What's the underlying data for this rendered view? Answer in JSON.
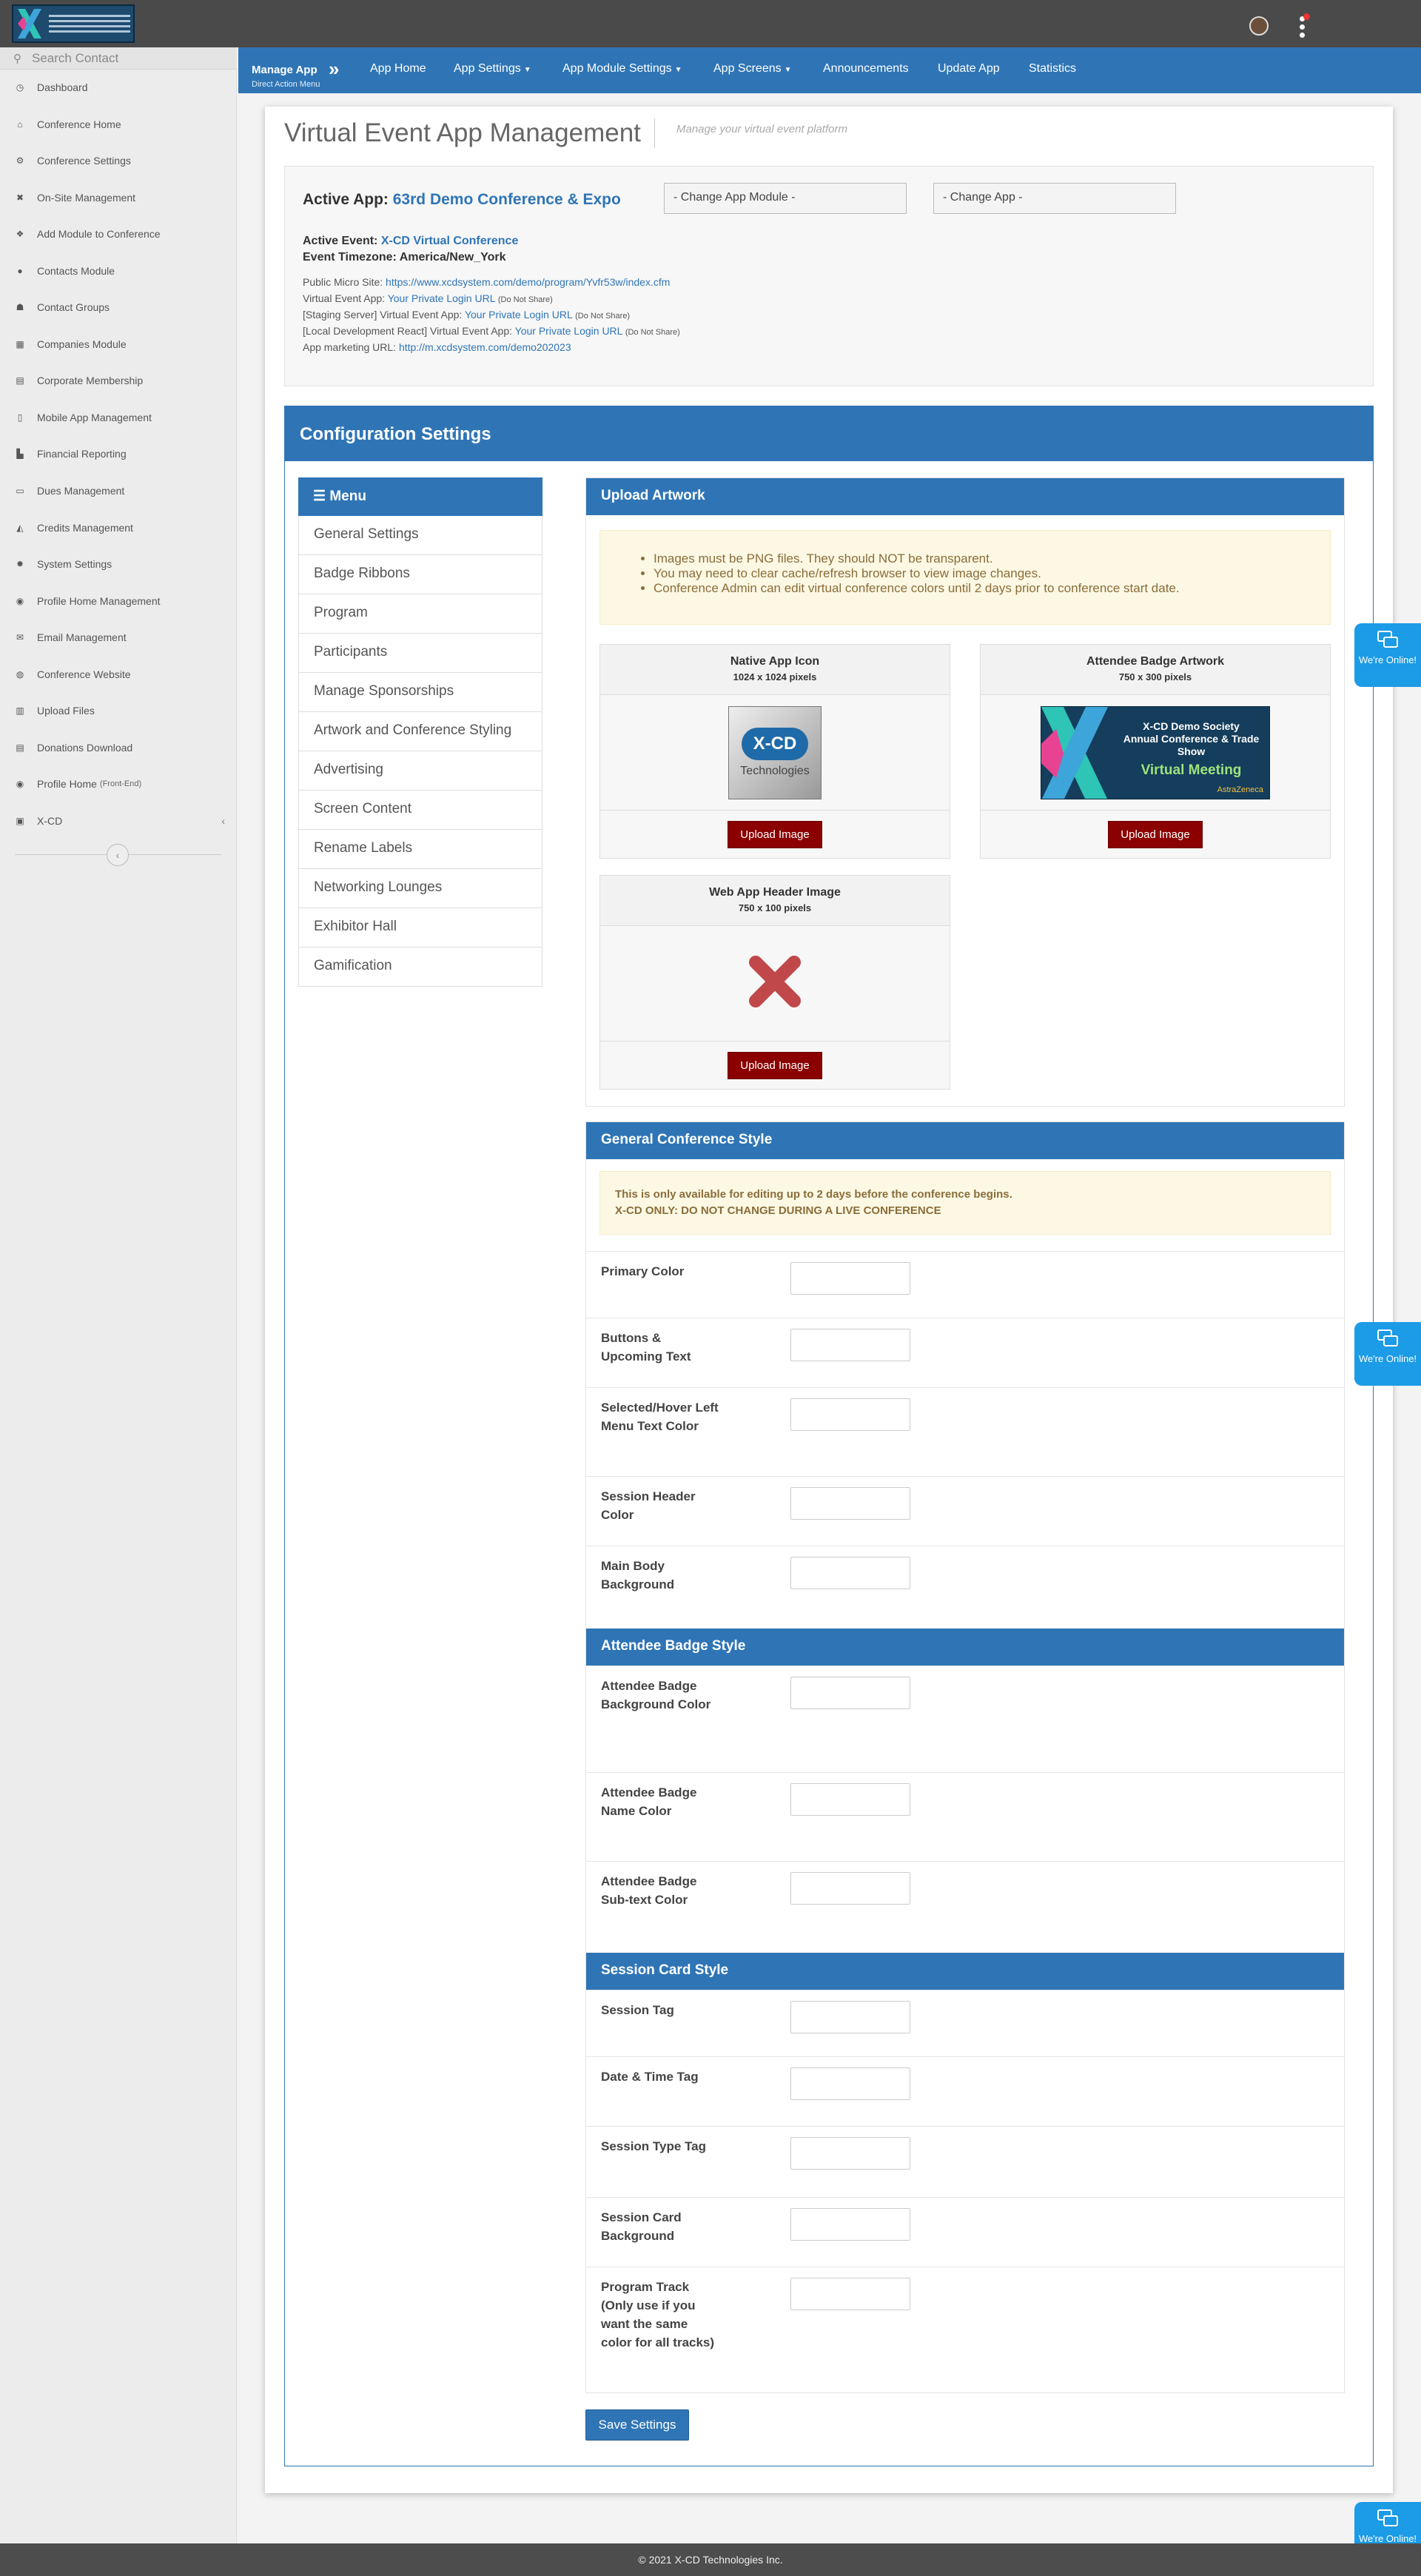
{
  "sidebar": {
    "search_placeholder": "Search Contact",
    "items": [
      {
        "icon": "dashboard-icon",
        "glyph": "◷",
        "label": "Dashboard"
      },
      {
        "icon": "home-icon",
        "glyph": "⌂",
        "label": "Conference Home"
      },
      {
        "icon": "gears-icon",
        "glyph": "⚙",
        "label": "Conference Settings"
      },
      {
        "icon": "tools-icon",
        "glyph": "✖",
        "label": "On-Site Management"
      },
      {
        "icon": "cubes-icon",
        "glyph": "❖",
        "label": "Add Module to Conference"
      },
      {
        "icon": "user-icon",
        "glyph": "●",
        "label": "Contacts Module"
      },
      {
        "icon": "users-icon",
        "glyph": "☗",
        "label": "Contact Groups"
      },
      {
        "icon": "building-icon",
        "glyph": "▦",
        "label": "Companies Module"
      },
      {
        "icon": "book-icon",
        "glyph": "▤",
        "label": "Corporate Membership"
      },
      {
        "icon": "mobile-icon",
        "glyph": "▯",
        "label": "Mobile App Management"
      },
      {
        "icon": "chart-icon",
        "glyph": "▙",
        "label": "Financial Reporting"
      },
      {
        "icon": "money-icon",
        "glyph": "▭",
        "label": "Dues Management"
      },
      {
        "icon": "graduation-icon",
        "glyph": "◭",
        "label": "Credits Management"
      },
      {
        "icon": "cog-icon",
        "glyph": "✹",
        "label": "System Settings"
      },
      {
        "icon": "user-circle-icon",
        "glyph": "◉",
        "label": "Profile Home Management"
      },
      {
        "icon": "envelope-icon",
        "glyph": "✉",
        "label": "Email Management"
      },
      {
        "icon": "globe-icon",
        "glyph": "◍",
        "label": "Conference Website"
      },
      {
        "icon": "upload-icon",
        "glyph": "▥",
        "label": "Upload Files"
      },
      {
        "icon": "download-icon",
        "glyph": "▤",
        "label": "Donations Download"
      },
      {
        "icon": "profile-icon",
        "glyph": "◉",
        "label": "Profile Home",
        "sub": "(Front-End)"
      },
      {
        "icon": "lock-icon",
        "glyph": "▣",
        "label": "X-CD",
        "caret": "‹"
      }
    ],
    "collapse_glyph": "‹"
  },
  "menubar": {
    "brand": "Manage App",
    "brand_sub": "Direct Action Menu",
    "chevron": "»",
    "items": [
      {
        "label": "App Home",
        "dropdown": ""
      },
      {
        "label": "App Settings",
        "dropdown": "▼"
      },
      {
        "label": "App Module Settings",
        "dropdown": "▼"
      },
      {
        "label": "App Screens",
        "dropdown": "▼"
      },
      {
        "label": "Announcements",
        "dropdown": ""
      },
      {
        "label": "Update App",
        "dropdown": ""
      },
      {
        "label": "Statistics",
        "dropdown": ""
      }
    ]
  },
  "page": {
    "title": "Virtual Event App Management",
    "subtitle": "Manage your virtual event platform"
  },
  "app_info": {
    "active_app_label": "Active App:",
    "active_app_value": "63rd Demo Conference & Expo",
    "active_event_label": "Active Event:",
    "active_event_value": "X-CD Virtual Conference",
    "timezone_label": "Event Timezone:",
    "timezone_value": "America/New_York",
    "micro_site_label": "Public Micro Site:",
    "micro_site_url": "https://www.xcdsystem.com/demo/program/Yvfr53w/index.cfm",
    "virtual_app_label": "Virtual Event App:",
    "virtual_app_link": "Your Private Login URL",
    "virtual_app_note": "(Do Not Share)",
    "staging_label": "[Staging Server] Virtual Event App:",
    "staging_link": "Your Private Login URL",
    "staging_note": "(Do Not Share)",
    "local_label": "[Local Development React] Virtual Event App:",
    "local_link": "Your Private Login URL",
    "local_note": "(Do Not Share)",
    "marketing_label": "App marketing URL:",
    "marketing_url": "http://m.xcdsystem.com/demo202023",
    "change_module": "- Change App Module -",
    "change_app": "- Change App -"
  },
  "config": {
    "title": "Configuration Settings",
    "menu_title": "Menu",
    "menu_items": [
      "General Settings",
      "Badge Ribbons",
      "Program",
      "Participants",
      "Manage Sponsorships",
      "Artwork and Conference Styling",
      "Advertising",
      "Screen Content",
      "Rename Labels",
      "Networking Lounges",
      "Exhibitor Hall",
      "Gamification"
    ]
  },
  "upload_artwork": {
    "title": "Upload Artwork",
    "notes": [
      "Images must be PNG files. They should NOT be transparent.",
      "You may need to clear cache/refresh browser to view image changes.",
      "Conference Admin can edit virtual conference colors until 2 days prior to conference start date."
    ],
    "cards": [
      {
        "title": "Native App Icon",
        "size": "1024 x 1024 pixels",
        "button": "Upload Image",
        "img_text_1": "X-CD",
        "img_text_2": "Technologies"
      },
      {
        "title": "Attendee Badge Artwork",
        "size": "750 x 300 pixels",
        "button": "Upload Image",
        "img_text_1": "X-CD Demo Society",
        "img_text_2": "Annual Conference & Trade Show",
        "img_text_3": "Virtual Meeting",
        "img_text_4": "AstraZeneca"
      },
      {
        "title": "Web App Header Image",
        "size": "750 x 100 pixels",
        "button": "Upload Image"
      }
    ]
  },
  "general_style": {
    "title": "General Conference Style",
    "notice_1": "This is only available for editing up to 2 days before the conference begins.",
    "notice_2": "X-CD ONLY: DO NOT CHANGE DURING A LIVE CONFERENCE",
    "fields": [
      "Primary Color",
      "Buttons & Upcoming Text",
      "Selected/Hover Left Menu Text Color",
      "Session Header Color",
      "Main Body Background"
    ]
  },
  "badge_style": {
    "title": "Attendee Badge Style",
    "fields": [
      "Attendee Badge Background Color",
      "Attendee Badge Name Color",
      "Attendee Badge Sub-text Color"
    ]
  },
  "session_style": {
    "title": "Session Card Style",
    "fields": [
      "Session Tag",
      "Date & Time Tag",
      "Session Type Tag",
      "Session Card Background",
      "Program Track (Only use if you want the same color for all tracks)"
    ]
  },
  "save_label": "Save Settings",
  "chat_label": "We're Online!",
  "footer": "© 2021 X-CD Technologies Inc.",
  "colors": {
    "primary": "#2f75b6",
    "danger": "#8b0000",
    "chat": "#1c9be6"
  }
}
